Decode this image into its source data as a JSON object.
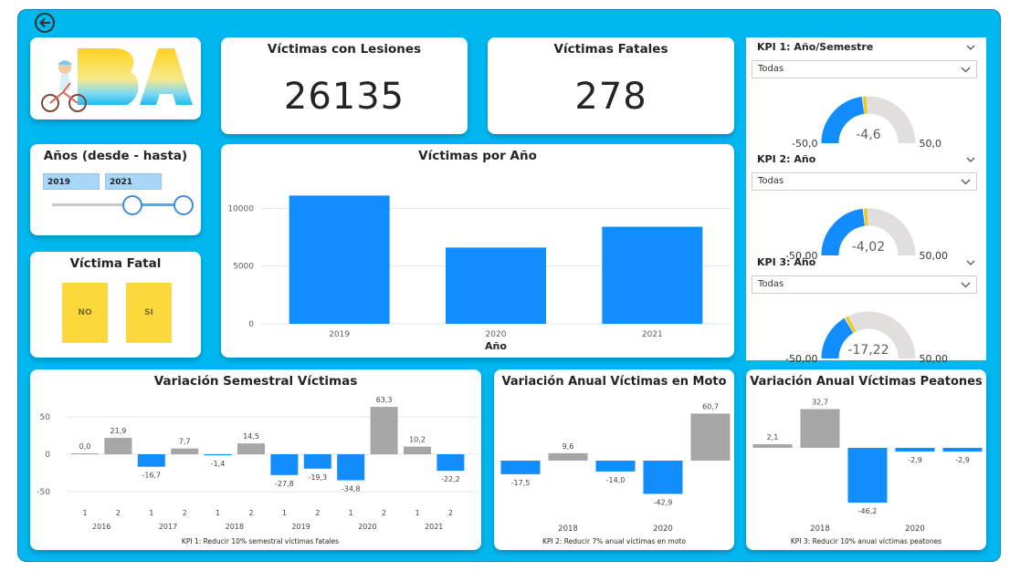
{
  "cards": {
    "lesiones": {
      "title": "Víctimas con Lesiones",
      "value": "26135"
    },
    "fatales": {
      "title": "Víctimas Fatales",
      "value": "278"
    }
  },
  "years_slicer": {
    "title": "Años (desde - hasta)",
    "from": "2019",
    "to": "2021"
  },
  "fatal_slicer": {
    "title": "Víctima Fatal",
    "options": [
      "NO",
      "SI"
    ]
  },
  "kpis": [
    {
      "title": "KPI 1: Año/Semestre",
      "dropdown": "Todas",
      "value_label": "-4,6",
      "min_label": "-50,0",
      "max_label": "50,0",
      "value": -4.6,
      "min": -50,
      "max": 50
    },
    {
      "title": "KPI 2: Año",
      "dropdown": "Todas",
      "value_label": "-4,02",
      "min_label": "-50,00",
      "max_label": "50,00",
      "value": -4.02,
      "min": -50,
      "max": 50
    },
    {
      "title": "KPI 3: Año",
      "dropdown": "Todas",
      "value_label": "-17,22",
      "min_label": "-50,00",
      "max_label": "50,00",
      "value": -17.22,
      "min": -50,
      "max": 50
    }
  ],
  "chart_data": [
    {
      "type": "bar",
      "title": "Víctimas por Año",
      "xlabel": "Año",
      "ylabel": "",
      "categories": [
        "2019",
        "2020",
        "2021"
      ],
      "values": [
        11100,
        6600,
        8400
      ],
      "yticks": [
        "0",
        "5000",
        "10000"
      ],
      "ylim": [
        0,
        12000
      ],
      "color": "#118dff"
    },
    {
      "type": "bar",
      "title": "Variación Semestral Víctimas",
      "footnote": "KPI 1: Reducir 10% semestral víctimas fatales",
      "categories": [
        "1",
        "2",
        "1",
        "2",
        "1",
        "2",
        "1",
        "2",
        "1",
        "2",
        "1",
        "2"
      ],
      "years": [
        "2016",
        "2017",
        "2018",
        "2019",
        "2020",
        "2021"
      ],
      "values": [
        0.0,
        21.9,
        -16.7,
        7.7,
        -1.4,
        14.5,
        -27.8,
        -19.3,
        -34.8,
        63.3,
        10.2,
        -22.2
      ],
      "labels": [
        "0,0",
        "21,9",
        "-16,7",
        "7,7",
        "-1,4",
        "14,5",
        "-27,8",
        "-19,3",
        "-34,8",
        "63,3",
        "10,2",
        "-22,2"
      ],
      "yticks": [
        "-50",
        "0",
        "50"
      ],
      "ylim": [
        -75,
        75
      ],
      "positive_color": "#a6a6a6",
      "negative_color": "#118dff"
    },
    {
      "type": "bar",
      "title": "Variación Anual Víctimas en Moto",
      "footnote": "KPI 2: Reducir 7% anual víctimas en moto",
      "values": [
        -17.5,
        9.6,
        -14.0,
        -42.9,
        60.7
      ],
      "labels": [
        "-17,5",
        "9,6",
        "-14,0",
        "-42,9",
        "60,7"
      ],
      "xtick_labels": [
        "2018",
        "2020"
      ],
      "ylim": [
        -55,
        75
      ],
      "positive_color": "#a6a6a6",
      "negative_color": "#118dff"
    },
    {
      "type": "bar",
      "title": "Variación Anual Víctimas Peatones",
      "footnote": "KPI 3: Reducir 10% anual víctimas peatones",
      "values": [
        2.1,
        32.7,
        -46.2,
        -2.9,
        -2.9
      ],
      "labels": [
        "2,1",
        "32,7",
        "-46,2",
        "-2,9",
        "-2,9"
      ],
      "xtick_labels": [
        "2018",
        "2020"
      ],
      "ylim": [
        -55,
        40
      ],
      "positive_color": "#a6a6a6",
      "negative_color": "#118dff"
    }
  ],
  "logo_text": "BA"
}
